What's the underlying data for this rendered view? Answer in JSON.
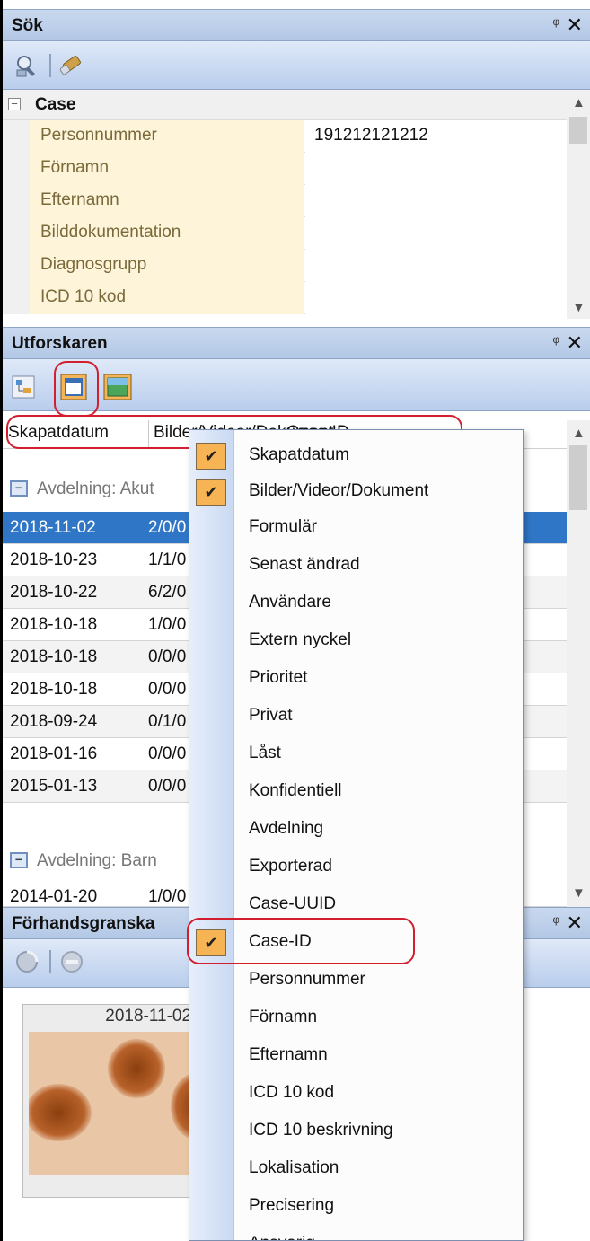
{
  "search_panel": {
    "title": "Sök",
    "category": "Case",
    "properties": [
      {
        "name": "Personnummer",
        "value": "191212121212"
      },
      {
        "name": "Förnamn",
        "value": ""
      },
      {
        "name": "Efternamn",
        "value": ""
      },
      {
        "name": "Bilddokumentation",
        "value": ""
      },
      {
        "name": "Diagnosgrupp",
        "value": ""
      },
      {
        "name": "ICD 10 kod",
        "value": ""
      }
    ]
  },
  "explorer_panel": {
    "title": "Utforskaren",
    "columns": {
      "created": "Skapatdatum",
      "media": "Bilder/Videor/Dokument",
      "case_id": "Case-ID"
    },
    "group1": "Avdelning: Akut",
    "rows": [
      {
        "date": "2018-11-02",
        "media": "2/0/0"
      },
      {
        "date": "2018-10-23",
        "media": "1/1/0"
      },
      {
        "date": "2018-10-22",
        "media": "6/2/0"
      },
      {
        "date": "2018-10-18",
        "media": "1/0/0"
      },
      {
        "date": "2018-10-18",
        "media": "0/0/0"
      },
      {
        "date": "2018-10-18",
        "media": "0/0/0"
      },
      {
        "date": "2018-09-24",
        "media": "0/1/0"
      },
      {
        "date": "2018-01-16",
        "media": "0/0/0"
      },
      {
        "date": "2015-01-13",
        "media": "0/0/0"
      }
    ],
    "group2": "Avdelning: Barn",
    "last_row": {
      "date": "2014-01-20",
      "media": "1/0/0"
    }
  },
  "preview_panel": {
    "title": "Förhandsgranska",
    "thumbnail_caption": "2018-11-02 12:"
  },
  "column_menu": {
    "items": [
      {
        "label": "Skapatdatum",
        "checked": true
      },
      {
        "label": "Bilder/Videor/Dokument",
        "checked": true
      },
      {
        "label": "Formulär",
        "checked": false
      },
      {
        "label": "Senast ändrad",
        "checked": false
      },
      {
        "label": "Användare",
        "checked": false
      },
      {
        "label": "Extern nyckel",
        "checked": false
      },
      {
        "label": "Prioritet",
        "checked": false
      },
      {
        "label": "Privat",
        "checked": false
      },
      {
        "label": "Låst",
        "checked": false
      },
      {
        "label": "Konfidentiell",
        "checked": false
      },
      {
        "label": "Avdelning",
        "checked": false
      },
      {
        "label": "Exporterad",
        "checked": false
      },
      {
        "label": "Case-UUID",
        "checked": false
      },
      {
        "label": "Case-ID",
        "checked": true
      },
      {
        "label": "Personnummer",
        "checked": false
      },
      {
        "label": "Förnamn",
        "checked": false
      },
      {
        "label": "Efternamn",
        "checked": false
      },
      {
        "label": "ICD 10 kod",
        "checked": false
      },
      {
        "label": "ICD 10 beskrivning",
        "checked": false
      },
      {
        "label": "Lokalisation",
        "checked": false
      },
      {
        "label": "Precisering",
        "checked": false
      },
      {
        "label": "Ansvarig",
        "checked": false
      }
    ]
  },
  "glyphs": {
    "pin": "ᵠ",
    "close": "✕",
    "check": "✔",
    "minus": "−",
    "up": "▲",
    "down": "▼"
  },
  "colors": {
    "selection": "#3076c7",
    "check_bg": "#f7b454",
    "highlight_ring": "#d21e2e",
    "titlebar": "#b3c8e6"
  }
}
